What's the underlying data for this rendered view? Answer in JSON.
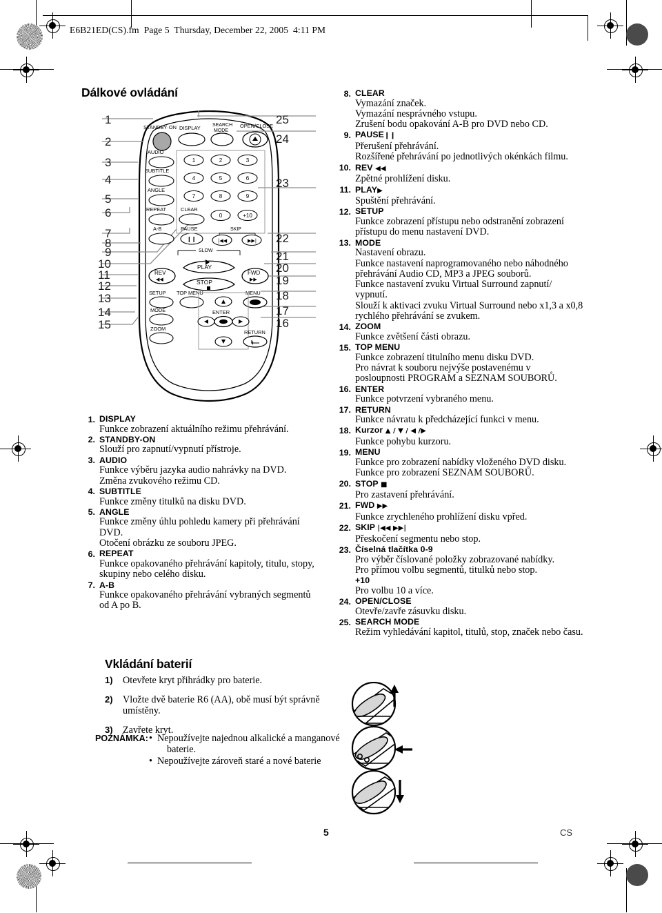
{
  "header": {
    "slug": "E6B21ED(CS).fm  Page 5  Thursday, December 22, 2005  4:11 PM"
  },
  "sections": {
    "remote_title": "Dálkové ovládání",
    "battery_title": "Vkládání baterií"
  },
  "remote": {
    "left_callouts": [
      "1",
      "2",
      "3",
      "4",
      "5",
      "6",
      "7",
      "8",
      "9",
      "10",
      "11",
      "12",
      "13",
      "14",
      "15"
    ],
    "right_callouts": [
      "25",
      "24",
      "23",
      "22",
      "21",
      "20",
      "19",
      "18",
      "17",
      "16"
    ],
    "button_labels": {
      "standby_on": "STANDBY·ON",
      "display": "DISPLAY",
      "search_mode_l1": "SEARCH",
      "search_mode_l2": "MODE",
      "open_close": "OPEN/CLOSE",
      "audio": "AUDIO",
      "subtitle": "SUBTITLE",
      "angle": "ANGLE",
      "repeat": "REPEAT",
      "clear": "CLEAR",
      "a_b": "A-B",
      "pause": "PAUSE",
      "skip": "SKIP",
      "slow": "SLOW",
      "play": "PLAY",
      "stop": "STOP",
      "rev": "REV",
      "fwd": "FWD",
      "setup": "SETUP",
      "top_menu": "TOP MENU",
      "menu": "MENU",
      "mode": "MODE",
      "enter": "ENTER",
      "zoom": "ZOOM",
      "return": "RETURN"
    },
    "keypad": [
      "1",
      "2",
      "3",
      "4",
      "5",
      "6",
      "7",
      "8",
      "9",
      "0",
      "+10"
    ]
  },
  "functions_left": [
    {
      "n": "1.",
      "title": "DISPLAY",
      "lines": [
        "Funkce zobrazení aktuálního režimu přehrávání."
      ]
    },
    {
      "n": "2.",
      "title": "STANDBY-ON",
      "lines": [
        "Slouží pro zapnutí/vypnutí přístroje."
      ]
    },
    {
      "n": "3.",
      "title": "AUDIO",
      "lines": [
        "Funkce výběru jazyka audio nahrávky na DVD.",
        "Změna zvukového režimu CD."
      ]
    },
    {
      "n": "4.",
      "title": "SUBTITLE",
      "lines": [
        "Funkce změny titulků na disku DVD."
      ]
    },
    {
      "n": "5.",
      "title": "ANGLE",
      "lines": [
        "Funkce změny úhlu pohledu kamery při přehrávání DVD.",
        "Otočení obrázku ze souboru JPEG."
      ]
    },
    {
      "n": "6.",
      "title": "REPEAT",
      "lines": [
        "Funkce opakovaného přehrávání kapitoly, titulu, stopy,",
        "skupiny nebo celého disku."
      ]
    },
    {
      "n": "7.",
      "title": "A-B",
      "lines": [
        "Funkce opakovaného přehrávání vybraných segmentů od A po B."
      ]
    }
  ],
  "functions_right": [
    {
      "n": "8.",
      "title": "CLEAR",
      "lines": [
        "Vymazání značek.",
        "Vymazání nesprávného vstupu.",
        "Zrušení bodu opakování A-B pro DVD nebo CD."
      ]
    },
    {
      "n": "9.",
      "title": "PAUSE",
      "glyph": "❙❙",
      "lines": [
        "Přerušení přehrávání.",
        "Rozšířené přehrávání po jednotlivých okénkách filmu."
      ]
    },
    {
      "n": "10.",
      "title": "REV",
      "glyph": "◀◀",
      "lines": [
        "Zpětné prohlížení disku."
      ]
    },
    {
      "n": "11.",
      "title": "PLAY",
      "glyph": "▶",
      "lines": [
        "Spuštění přehrávání."
      ]
    },
    {
      "n": "12.",
      "title": "SETUP",
      "lines": [
        "Funkce zobrazení přístupu nebo odstranění zobrazení",
        "přístupu do menu nastavení DVD."
      ]
    },
    {
      "n": "13.",
      "title": "MODE",
      "lines": [
        "Nastavení obrazu.",
        "Funkce nastavení naprogramovaného nebo náhodného",
        "přehrávání Audio CD, MP3 a JPEG souborů.",
        "Funkce nastavení zvuku Virtual Surround zapnutí/",
        "vypnutí.",
        "Slouží k aktivaci zvuku Virtual Surround nebo x1,3 a x0,8",
        "rychlého přehrávání se zvukem."
      ]
    },
    {
      "n": "14.",
      "title": "ZOOM",
      "lines": [
        "Funkce zvětšení části obrazu."
      ]
    },
    {
      "n": "15.",
      "title": "TOP MENU",
      "lines": [
        "Funkce zobrazení titulního menu disku DVD.",
        "Pro návrat k souboru nejvýše postavenému v",
        "posloupnosti PROGRAM a SEZNAM SOUBORŮ."
      ]
    },
    {
      "n": "16.",
      "title": "ENTER",
      "lines": [
        "Funkce potvrzení vybraného menu."
      ]
    },
    {
      "n": "17.",
      "title": "RETURN",
      "lines": [
        "Funkce návratu k předcházející funkci v menu."
      ]
    },
    {
      "n": "18.",
      "title": "Kurzor",
      "glyph": "▲ / ▼ / ◀ /▶",
      "lines": [
        "Funkce pohybu kurzoru."
      ]
    },
    {
      "n": "19.",
      "title": "MENU",
      "lines": [
        "Funkce pro zobrazení nabídky vloženého DVD disku.",
        "Funkce pro zobrazení SEZNAM SOUBORŮ."
      ]
    },
    {
      "n": "20.",
      "title": "STOP",
      "glyph": "■",
      "lines": [
        "Pro zastavení přehrávání."
      ]
    },
    {
      "n": "21.",
      "title": "FWD",
      "glyph": "▶▶",
      "lines": [
        "Funkce zrychleného prohlížení disku vpřed."
      ]
    },
    {
      "n": "22.",
      "title": "SKIP",
      "glyph": "|◀◀ ▶▶|",
      "lines": [
        "Přeskočení segmentu nebo stop."
      ]
    },
    {
      "n": "23.",
      "title": "Číselná tlačítka 0-9",
      "lines": [
        "Pro výběr číslované položky zobrazované nabídky.",
        "Pro přímou volbu segmentů, titulků nebo stop."
      ],
      "sub_title": "+10",
      "sub_lines": [
        "Pro volbu 10 a více."
      ]
    },
    {
      "n": "24.",
      "title": "OPEN/CLOSE",
      "lines": [
        "Otevře/zavře zásuvku disku."
      ]
    },
    {
      "n": "25.",
      "title": "SEARCH MODE",
      "lines": [
        "Režim vyhledávání kapitol, titulů, stop, značek nebo času."
      ]
    }
  ],
  "battery_steps": [
    {
      "n": "1)",
      "text": "Otevřete kryt přihrádky pro baterie."
    },
    {
      "n": "2)",
      "text": "Vložte dvě baterie R6 (AA), obě musí být správně umístěny."
    },
    {
      "n": "3)",
      "text": "Zavřete kryt."
    }
  ],
  "note": {
    "label": "POZNÁMKA:",
    "bullets": [
      "Nepoužívejte najednou alkalické a manganové baterie",
      "Nepoužívejte zároveň staré a nové baterie"
    ],
    "bullet1_line1": "Nepoužívejte najednou alkalické a manganové",
    "bullet1_line2": "baterie.",
    "bullet2_line1": "Nepoužívejte zároveň staré a nové baterie"
  },
  "footer": {
    "page_number": "5",
    "language_code": "CS"
  }
}
